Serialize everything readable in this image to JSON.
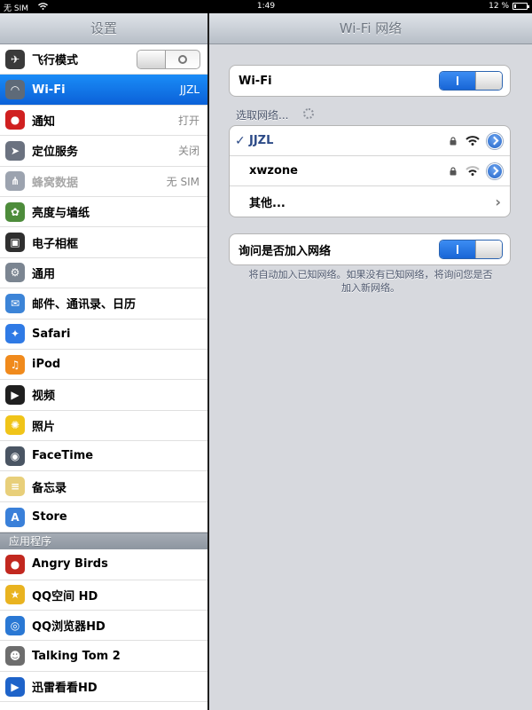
{
  "status": {
    "carrier": "无 SIM",
    "time": "1:49",
    "battery": "12 %",
    "battery_level": 0.12
  },
  "master": {
    "title": "设置",
    "items": [
      {
        "label": "飞行模式",
        "value": "",
        "icon": "airplane-icon",
        "color": "#3a3a3a",
        "toggle": "off"
      },
      {
        "label": "Wi-Fi",
        "value": "JJZL",
        "icon": "wifi-icon",
        "color": "#5e6a78",
        "selected": true
      },
      {
        "label": "通知",
        "value": "打开",
        "icon": "notifications-icon",
        "color": "#d02020"
      },
      {
        "label": "定位服务",
        "value": "关闭",
        "icon": "location-icon",
        "color": "#6b7280"
      },
      {
        "label": "蜂窝数据",
        "value": "无 SIM",
        "icon": "cellular-icon",
        "color": "#9ca3af",
        "disabled": true
      },
      {
        "label": "亮度与墙纸",
        "value": "",
        "icon": "brightness-icon",
        "color": "#4d8c3b"
      },
      {
        "label": "电子相框",
        "value": "",
        "icon": "picture-frame-icon",
        "color": "#2f2f2f"
      },
      {
        "label": "通用",
        "value": "",
        "icon": "gear-icon",
        "color": "#7b8591"
      },
      {
        "label": "邮件、通讯录、日历",
        "value": "",
        "icon": "mail-icon",
        "color": "#3c84d7"
      },
      {
        "label": "Safari",
        "value": "",
        "icon": "safari-icon",
        "color": "#2f7ae5"
      },
      {
        "label": "iPod",
        "value": "",
        "icon": "ipod-icon",
        "color": "#f08a1c"
      },
      {
        "label": "视频",
        "value": "",
        "icon": "video-icon",
        "color": "#1f1f1f"
      },
      {
        "label": "照片",
        "value": "",
        "icon": "photos-icon",
        "color": "#f0c419"
      },
      {
        "label": "FaceTime",
        "value": "",
        "icon": "facetime-icon",
        "color": "#4a5563"
      },
      {
        "label": "备忘录",
        "value": "",
        "icon": "notes-icon",
        "color": "#e8cf7a"
      },
      {
        "label": "Store",
        "value": "",
        "icon": "store-icon",
        "color": "#3a80d9"
      }
    ],
    "apps_header": "应用程序",
    "apps": [
      {
        "label": "Angry Birds",
        "icon": "angry-birds-icon",
        "color": "#c2281f"
      },
      {
        "label": "QQ空间 HD",
        "icon": "qzone-icon",
        "color": "#e9b320"
      },
      {
        "label": "QQ浏览器HD",
        "icon": "qq-browser-icon",
        "color": "#2a78d4"
      },
      {
        "label": "Talking Tom 2",
        "icon": "talking-tom-icon",
        "color": "#6d6d6d"
      },
      {
        "label": "迅雷看看HD",
        "icon": "xunlei-icon",
        "color": "#1e63c9"
      }
    ]
  },
  "detail": {
    "title": "Wi-Fi 网络",
    "wifi_label": "Wi-Fi",
    "wifi_on": "I",
    "choose_network": "选取网络...",
    "networks": [
      {
        "name": "JJZL",
        "checked": "✓",
        "locked": true
      },
      {
        "name": "xwzone",
        "checked": "",
        "locked": true
      }
    ],
    "other": "其他...",
    "ask_to_join": "询问是否加入网络",
    "ask_on": "I",
    "footnote": "将自动加入已知网络。如果没有已知网络，将询问您是否加入新网络。"
  }
}
